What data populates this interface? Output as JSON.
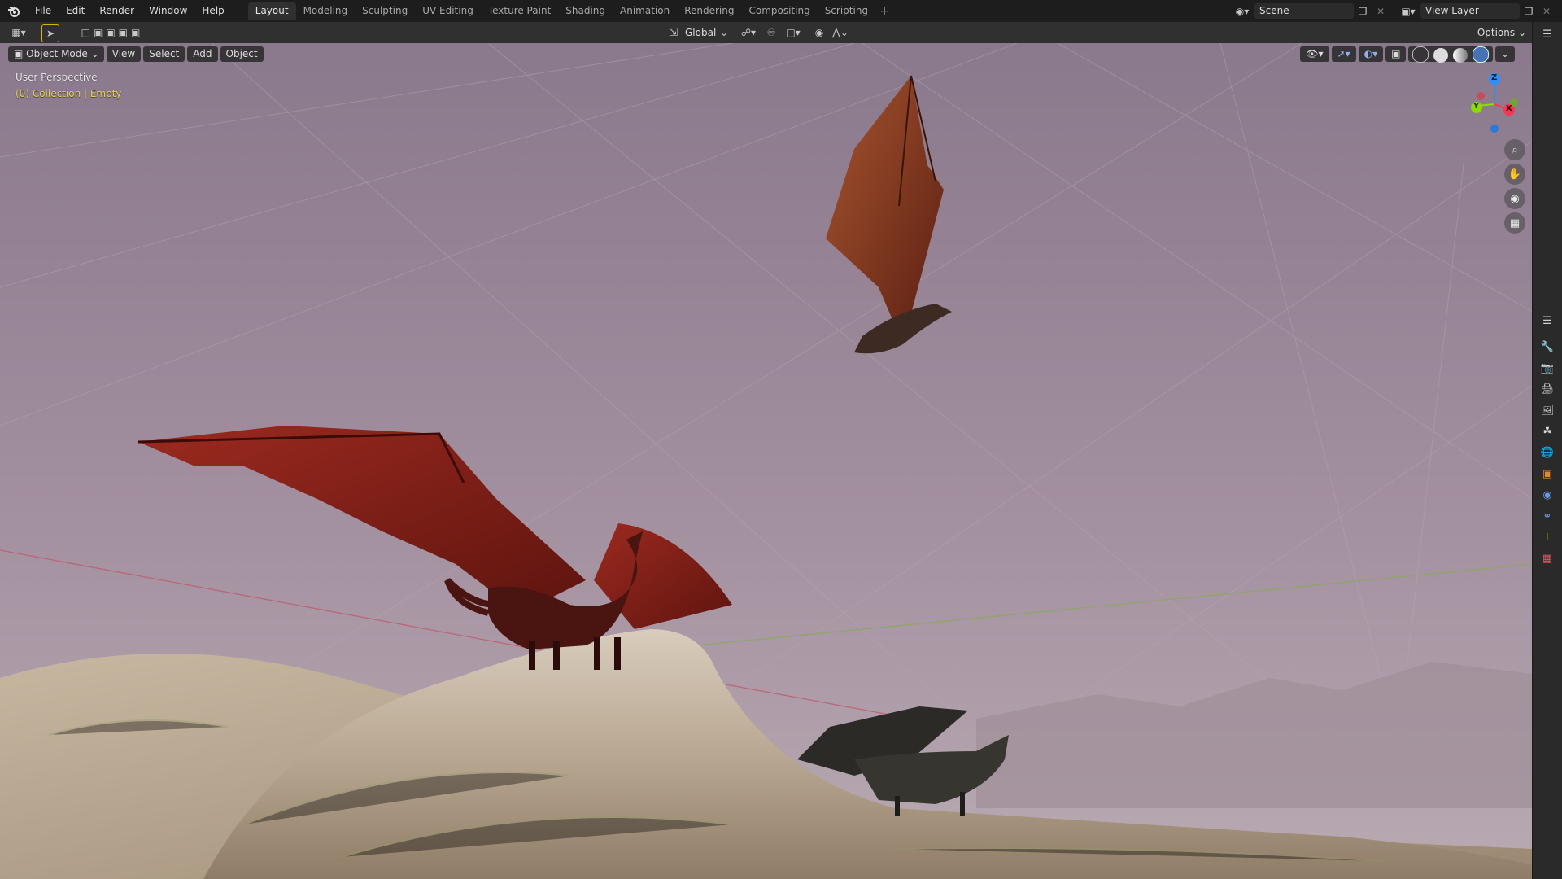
{
  "menu": [
    "File",
    "Edit",
    "Render",
    "Window",
    "Help"
  ],
  "workspaces": [
    "Layout",
    "Modeling",
    "Sculpting",
    "UV Editing",
    "Texture Paint",
    "Shading",
    "Animation",
    "Rendering",
    "Compositing",
    "Scripting"
  ],
  "active_workspace": "Layout",
  "scene": {
    "label": "Scene",
    "view_layer": "View Layer"
  },
  "toolbar": {
    "transform_orientation": "Global",
    "options_label": "Options"
  },
  "viewport_header": {
    "mode": "Object Mode",
    "view": "View",
    "select": "Select",
    "add": "Add",
    "object": "Object"
  },
  "overlay": {
    "perspective": "User Perspective",
    "collection": "(0) Collection | Empty"
  },
  "gizmo": {
    "x": "X",
    "y": "Y",
    "z": "Z"
  },
  "colors": {
    "accent_blue": "#4772b3",
    "active_yellow": "#e6d04a",
    "x_axis": "#ff3352",
    "y_axis": "#8bdc00",
    "z_axis": "#2890ff"
  },
  "icons": [
    "blender-logo-icon",
    "select-box-icon",
    "zoom-icon",
    "hand-pan-icon",
    "camera-icon",
    "grid-persp-icon"
  ]
}
